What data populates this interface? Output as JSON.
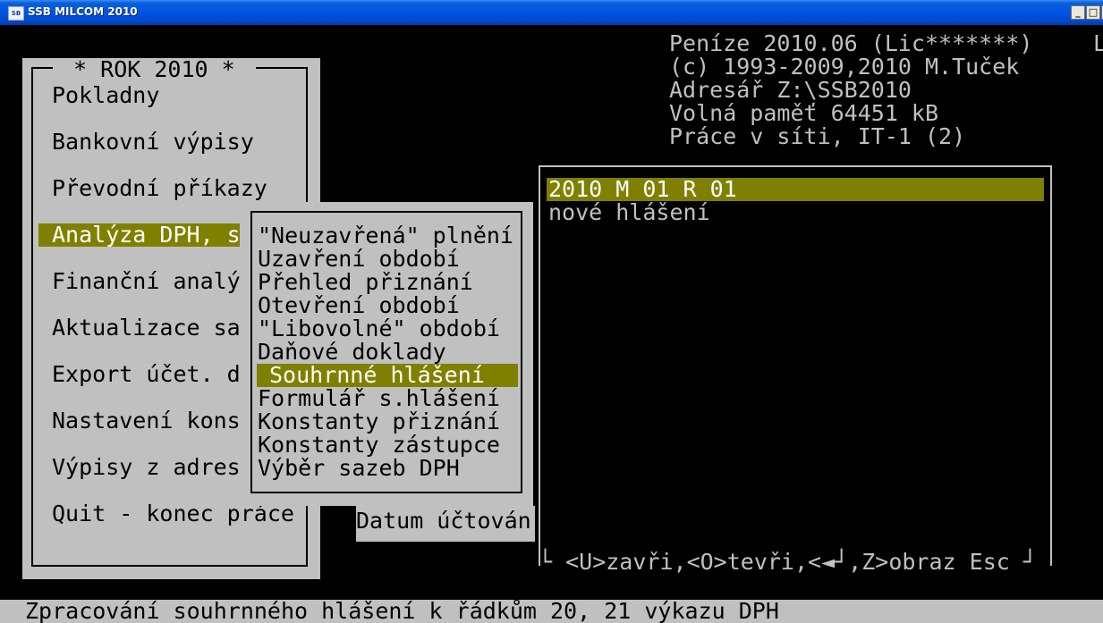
{
  "window": {
    "title": "SSB MILCOM 2010",
    "icon_label": "SB",
    "buttons": {
      "minimize": "_",
      "maximize": "□",
      "close": "×"
    }
  },
  "info": {
    "lines": [
      "Peníze 2010.06 (Lic*******)",
      "(c) 1993-2009,2010 M.Tuček",
      "Adresář Z:\\SSB2010",
      "Volná paměť 64451 kB",
      "Práce v síti, IT-1 (2)"
    ],
    "tail": "L"
  },
  "main_menu": {
    "title": " * ROK 2010 * ",
    "items": [
      "Pokladny",
      "Bankovní výpisy",
      "Převodní příkazy",
      "Analýza DPH, s",
      "Finanční analý",
      "Aktualizace sa",
      "Export účet. d",
      "Nastavení kons",
      "Výpisy z adres",
      "Quit - konec práce"
    ]
  },
  "sub_menu": {
    "items": [
      "\"Neuzavřená\" plnění",
      "Uzavření období",
      "Přehled přiznání",
      "Otevření období",
      "\"Libovolné\" období",
      "Daňové doklady",
      "Souhrnné hlášení",
      "Formulář s.hlášení",
      "Konstanty přiznání",
      "Konstanty zástupce",
      "Výběr sazeb DPH"
    ]
  },
  "datum_label": "Datum účtován",
  "list": {
    "selected": "2010 M 01 R 01",
    "items": [
      "nové hlášení"
    ],
    "footer": "└ <U>zavři,<O>tevři,<◄┘,Z>obraz Esc ┘"
  },
  "status": "Zpracování souhrnného hlášení k řádkům 20, 21 výkazu DPH",
  "colors": {
    "console_bg": "#000000",
    "panel_gray": "#c0c0c0",
    "highlight": "#808000",
    "titlebar": "#0054e3"
  }
}
